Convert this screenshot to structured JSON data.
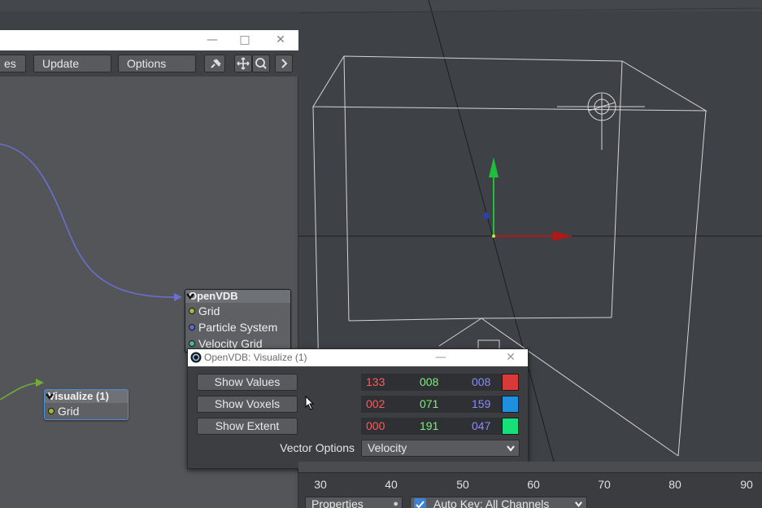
{
  "node_editor": {
    "toolbar": {
      "partial_label": "es",
      "update_label": "Update",
      "options_label": "Options"
    },
    "nodes": {
      "openvdb": {
        "title": "OpenVDB",
        "inputs": [
          "Grid",
          "Particle System",
          "Velocity Grid"
        ]
      },
      "visualize": {
        "title": "Visualize (1)",
        "inputs": [
          "Grid"
        ]
      }
    },
    "colors": {
      "connection_purple": "#6a6fd0",
      "connection_green": "#6fae3a",
      "port_grid": "#a6b43c",
      "port_particle": "#5a68d8",
      "port_velocity": "#4cb890"
    }
  },
  "viz_dialog": {
    "title": "OpenVDB: Visualize (1)",
    "rows": [
      {
        "button": "Show Values",
        "r": "133",
        "g": "008",
        "b": "008",
        "swatch": "#d83a3a"
      },
      {
        "button": "Show Voxels",
        "r": "002",
        "g": "071",
        "b": "159",
        "swatch": "#1f8fe0"
      },
      {
        "button": "Show Extent",
        "r": "000",
        "g": "191",
        "b": "047",
        "swatch": "#17e07a"
      }
    ],
    "vector_options_label": "Vector Options",
    "vector_options_value": "Velocity",
    "colors": {
      "r": "#ff5a5a",
      "g": "#7cf07c",
      "b": "#8a8aff"
    }
  },
  "timeline": {
    "ticks": [
      "30",
      "40",
      "50",
      "60",
      "70",
      "80",
      "90"
    ],
    "properties_label": "Properties",
    "autokey_label": "Auto Key: All Channels"
  }
}
